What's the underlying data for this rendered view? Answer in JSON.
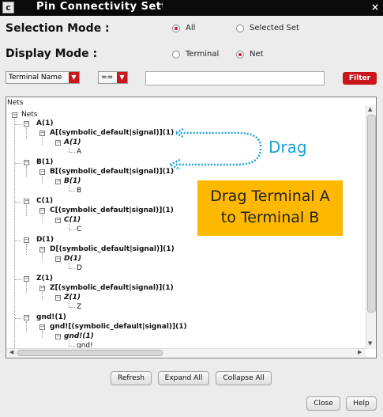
{
  "window": {
    "title": "Pin Connectivity Setting",
    "close_glyph": "×"
  },
  "selection_mode": {
    "label": "Selection Mode :",
    "options": [
      {
        "label": "All",
        "selected": true
      },
      {
        "label": "Selected Set",
        "selected": false
      }
    ]
  },
  "display_mode": {
    "label": "Display Mode :",
    "options": [
      {
        "label": "Terminal",
        "selected": false
      },
      {
        "label": "Net",
        "selected": true
      }
    ]
  },
  "filter_bar": {
    "field": "Terminal Name",
    "operator": "==",
    "value": "",
    "button_label": "Filter"
  },
  "tree": {
    "header": "Nets",
    "root": "Nets",
    "nets": [
      {
        "net": "A(1)",
        "term": "A[(symbolic_default|signal)](1)",
        "pin": "A(1)",
        "leaf": "A"
      },
      {
        "net": "B(1)",
        "term": "B[(symbolic_default|signal)](1)",
        "pin": "B(1)",
        "leaf": "B"
      },
      {
        "net": "C(1)",
        "term": "C[(symbolic_default|signal)](1)",
        "pin": "C(1)",
        "leaf": "C"
      },
      {
        "net": "D(1)",
        "term": "D[(symbolic_default|signal)](1)",
        "pin": "D(1)",
        "leaf": "D"
      },
      {
        "net": "Z(1)",
        "term": "Z[(symbolic_default|signal)](1)",
        "pin": "Z(1)",
        "leaf": "Z"
      },
      {
        "net": "gnd!(1)",
        "term": "gnd![(symbolic_default|signal)](1)",
        "pin": "gnd!(1)",
        "leaf": "gnd!"
      }
    ]
  },
  "annotations": {
    "drag": "Drag",
    "callout_line1": "Drag Terminal A",
    "callout_line2": "to Terminal B",
    "arrow_color": "#1aa3d8",
    "callout_color": "#ffb800"
  },
  "actions": {
    "refresh": "Refresh",
    "expand_all": "Expand All",
    "collapse_all": "Collapse All",
    "close": "Close",
    "help": "Help"
  },
  "colors": {
    "accent": "#c8161a",
    "titlebar": "#0a0a0a"
  }
}
